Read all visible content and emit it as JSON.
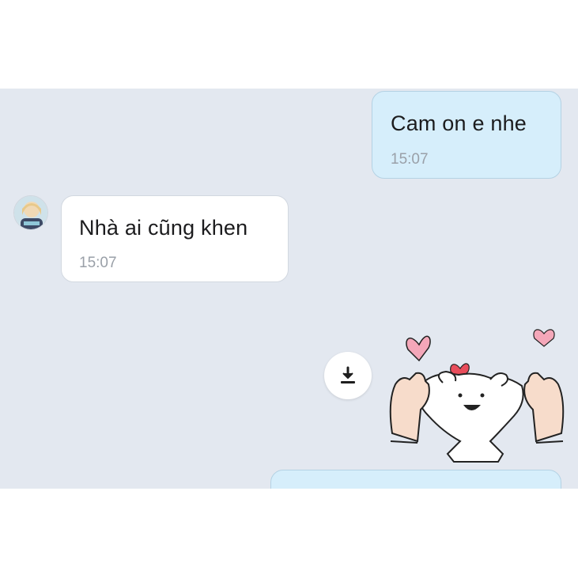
{
  "messages": [
    {
      "direction": "outgoing",
      "text": "Cam on e nhe",
      "time": "15:07"
    },
    {
      "direction": "incoming",
      "text": "Nhà ai cũng khen",
      "time": "15:07"
    },
    {
      "direction": "outgoing",
      "type": "sticker",
      "sticker_icon": "hands-holding-creature-with-hearts"
    },
    {
      "direction": "outgoing",
      "text": "",
      "time": ""
    }
  ],
  "icons": {
    "download": "download-icon",
    "avatar": "contact-avatar"
  },
  "colors": {
    "chat_background": "#e3e8f0",
    "outgoing_bubble": "#d6eefb",
    "incoming_bubble": "#ffffff",
    "time_text": "#9aa0a8"
  }
}
